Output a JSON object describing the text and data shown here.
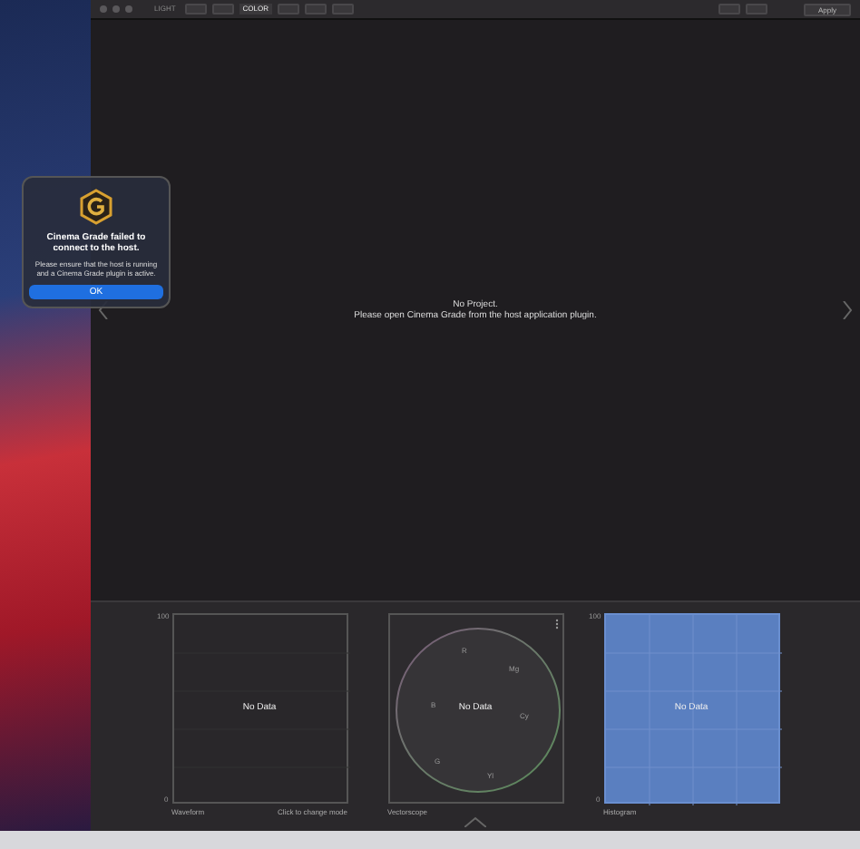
{
  "toolbar": {
    "tabs": [
      {
        "label": "LIGHT",
        "selected": false
      },
      {
        "label": "COLOR",
        "selected": true
      }
    ],
    "apply_button": "Apply"
  },
  "main": {
    "message_title": "No Project.",
    "message_body": "Please open Cinema Grade from the host application plugin."
  },
  "scopes": [
    {
      "kind": "waveform",
      "title": "Waveform",
      "status": "No Data",
      "y_max": "100",
      "y_min": "0",
      "hint": "Click to change mode"
    },
    {
      "kind": "vectorscope",
      "title": "Vectorscope",
      "status": "No Data",
      "targets": [
        "R",
        "Mg",
        "B",
        "Cy",
        "G",
        "Yl"
      ]
    },
    {
      "kind": "histogram",
      "title": "Histogram",
      "status": "No Data",
      "y_max": "100",
      "y_min": "0"
    }
  ],
  "dialog": {
    "title": "Cinema Grade failed to connect to the host.",
    "message": "Please ensure that the host is running and a Cinema Grade plugin is active.",
    "button": "OK"
  }
}
